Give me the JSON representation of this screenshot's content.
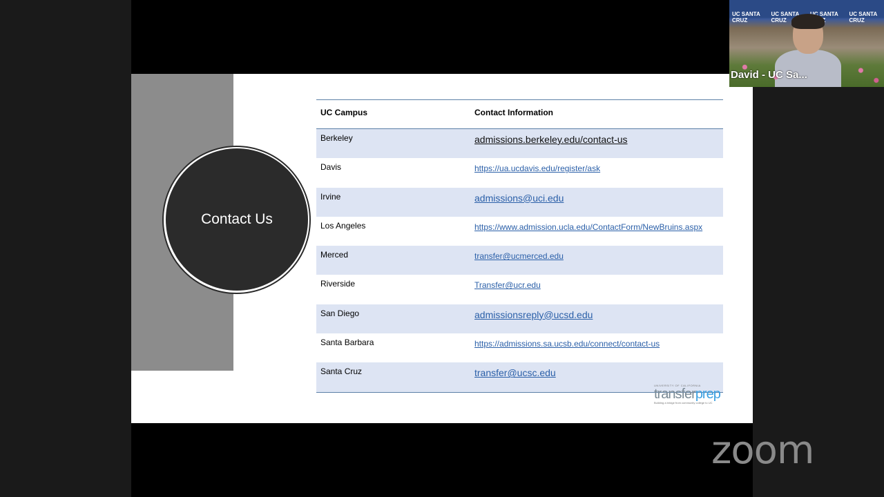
{
  "slide": {
    "title": "Contact Us",
    "table": {
      "headers": [
        "UC Campus",
        "Contact Information"
      ],
      "rows": [
        {
          "campus": "Berkeley",
          "contact": "admissions.berkeley.edu/contact-us"
        },
        {
          "campus": "Davis",
          "contact": "https://ua.ucdavis.edu/register/ask"
        },
        {
          "campus": "Irvine",
          "contact": "admissions@uci.edu"
        },
        {
          "campus": "Los Angeles",
          "contact": "https://www.admission.ucla.edu/ContactForm/NewBruins.aspx"
        },
        {
          "campus": "Merced",
          "contact": "transfer@ucmerced.edu"
        },
        {
          "campus": "Riverside",
          "contact": "Transfer@ucr.edu"
        },
        {
          "campus": "San Diego",
          "contact": "admissionsreply@ucsd.edu"
        },
        {
          "campus": "Santa Barbara",
          "contact": "https://admissions.sa.ucsb.edu/connect/contact-us"
        },
        {
          "campus": "Santa Cruz",
          "contact": "transfer@ucsc.edu"
        }
      ]
    },
    "logo": {
      "univ": "UNIVERSITY OF CALIFORNIA",
      "part1": "transfer",
      "part2": "prep",
      "tagline": "Building a bridge from community college to UC"
    }
  },
  "video": {
    "participant_name": "David - UC Sa...",
    "banner_text": "UC SANTA CRUZ"
  },
  "app": {
    "brand": "zoom"
  }
}
